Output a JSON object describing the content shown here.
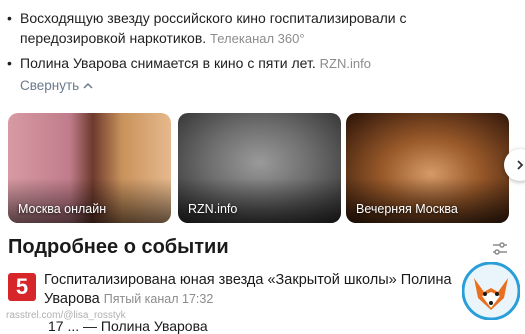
{
  "bullets": [
    {
      "text": "Восходящую звезду российского кино госпитализировали с передозировкой наркотиков.",
      "source": "Телеканал 360°"
    },
    {
      "text": "Полина Уварова снимается в кино с пяти лет.",
      "source": "RZN.info"
    }
  ],
  "collapse_label": "Свернуть",
  "carousel": [
    {
      "label": "Москва онлайн"
    },
    {
      "label": "RZN.info"
    },
    {
      "label": "Вечерняя Москва"
    }
  ],
  "section_title": "Подробнее о событии",
  "news": {
    "title": "Госпитализирована юная звезда «Закрытой школы» Полина Уварова",
    "logo_text": "5",
    "source": "Пятый канал",
    "time": "17:32",
    "logo_color": "#d7262a"
  },
  "next_news_text": "17 ... — Полина Уварова",
  "watermark": "rasstrel.com/@lisa_rosstyk"
}
